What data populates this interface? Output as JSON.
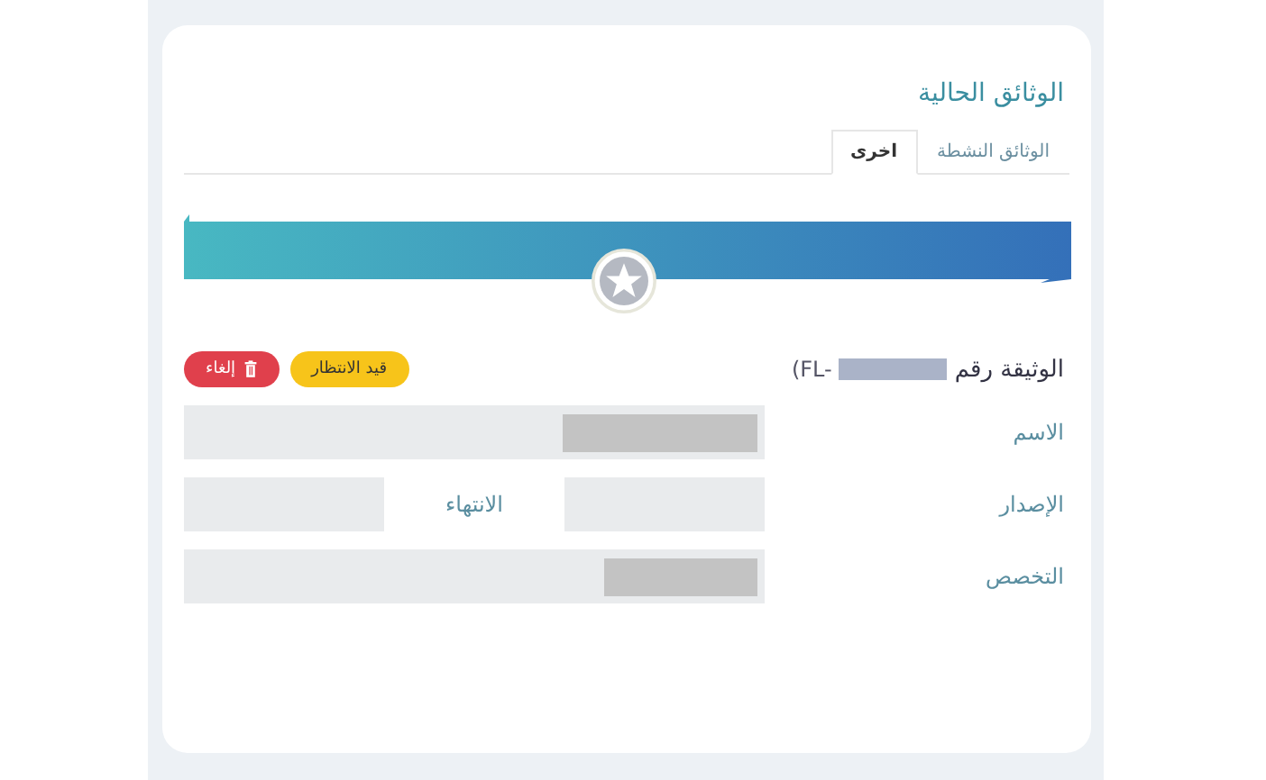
{
  "title": "الوثائق الحالية",
  "tabs": [
    {
      "label": "الوثائق النشطة",
      "selected": false
    },
    {
      "label": "اخرى",
      "selected": true
    }
  ],
  "document": {
    "label": "الوثيقة رقم",
    "number_prefix": "(FL-",
    "status": "قيد الانتظار",
    "cancel_button": "إلغاء"
  },
  "fields": [
    {
      "kind": "single",
      "label": "الاسم"
    },
    {
      "kind": "pair",
      "label": "الإصدار",
      "second_label": "الانتهاء"
    },
    {
      "kind": "single",
      "label": "التخصص"
    }
  ]
}
